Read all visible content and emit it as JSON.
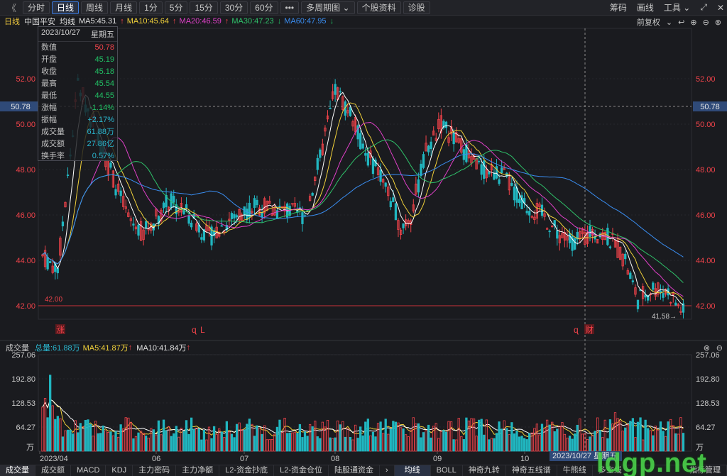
{
  "toolbar": {
    "back": "《",
    "periods": [
      "分时",
      "日线",
      "周线",
      "月线",
      "1分",
      "5分",
      "15分",
      "30分",
      "60分"
    ],
    "active_period": "日线",
    "more": "•••",
    "multi": "多周期图",
    "stock_info": "个股资料",
    "diagnose": "诊股",
    "right": {
      "chips": "筹码",
      "draw": "画线",
      "tools": "工具"
    }
  },
  "header": {
    "period": "日线",
    "name": "中国平安",
    "avg_label": "均线",
    "ma5": "MA5:45.31",
    "ma10": "MA10:45.64",
    "ma20": "MA20:46.59",
    "ma30": "MA30:47.23",
    "ma60": "MA60:47.95",
    "adjust": "前复权"
  },
  "infobox": {
    "date": "2023/10/27",
    "weekday": "星期五",
    "rows": [
      {
        "label": "数值",
        "value": "50.78"
      },
      {
        "label": "开盘",
        "value": "45.19"
      },
      {
        "label": "收盘",
        "value": "45.18"
      },
      {
        "label": "最高",
        "value": "45.54"
      },
      {
        "label": "最低",
        "value": "44.55"
      },
      {
        "label": "涨幅",
        "value": "-1.14%"
      },
      {
        "label": "振幅",
        "value": "+2.17%"
      },
      {
        "label": "成交量",
        "value": "61.88万"
      },
      {
        "label": "成交额",
        "value": "27.86亿"
      },
      {
        "label": "换手率",
        "value": "0.57%"
      }
    ]
  },
  "price_axis": [
    "52.00",
    "50.00",
    "48.00",
    "46.00",
    "44.00",
    "42.00"
  ],
  "cursor_price": "50.78",
  "support_line": "42.00",
  "low_mark": "41.58→",
  "markers": {
    "zhang": "涨",
    "l": "L",
    "cai": "财"
  },
  "volume_head": {
    "title": "成交量",
    "total": "总量:61.88万",
    "ma5": "MA5:41.87万",
    "ma10": "MA10:41.84万"
  },
  "vol_axis": [
    "257.06",
    "192.80",
    "128.53",
    "64.27",
    "万"
  ],
  "time_axis": [
    "2023/04",
    "06",
    "07",
    "08",
    "09",
    "10"
  ],
  "cursor_date": "2023/10/27  星期五",
  "bottom_tabs": [
    "成交量",
    "成交额",
    "MACD",
    "KDJ",
    "主力密码",
    "主力净额",
    "L2-资金抄底",
    "L2-资金仓位",
    "陆股通资金"
  ],
  "bottom_tabs_right": [
    "均线",
    "BOLL",
    "神奇九转",
    "神奇五线谱",
    "牛熊线",
    "多空线",
    "指标管理"
  ],
  "watermark": "ldgp.net",
  "colors": {
    "up": "#f0434a",
    "down": "#21b6c0",
    "ma5": "#ffffff",
    "ma10": "#f1d13a",
    "ma20": "#e040c8",
    "ma30": "#2fc26a",
    "ma60": "#3a8df0"
  }
}
